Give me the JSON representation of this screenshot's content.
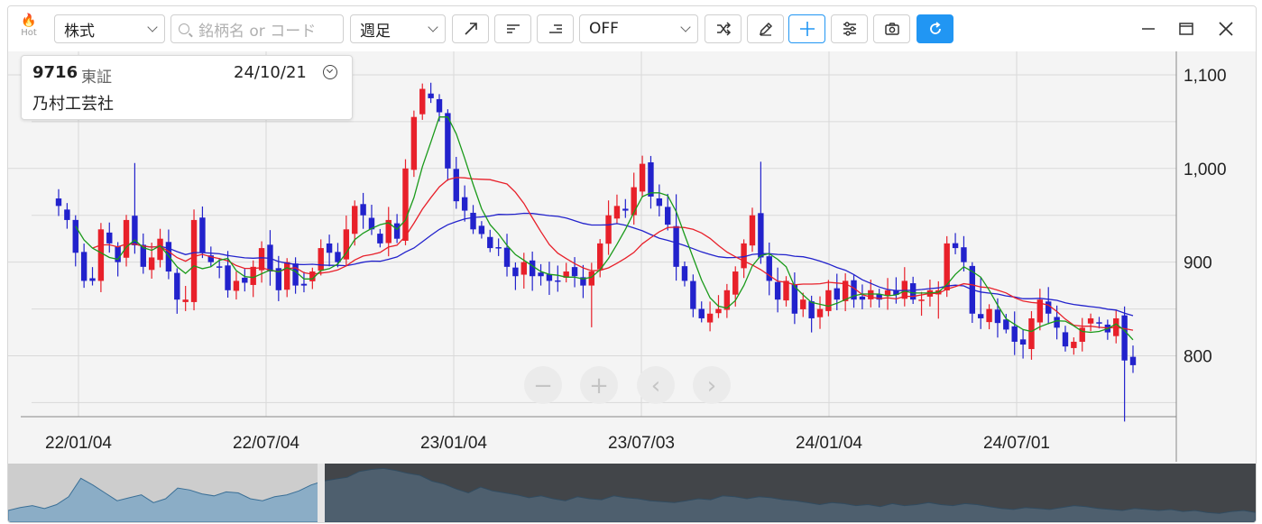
{
  "toolbar": {
    "hot_label": "Hot",
    "security_type": "株式",
    "search_placeholder": "銘柄名 or コード",
    "period": "週足",
    "indicator": "OFF",
    "icons": [
      "trend-line-icon",
      "horizontal-lines-icon",
      "right-aligned-lines-icon",
      "shuffle-icon",
      "pencil-icon",
      "crosshair-icon",
      "settings-sliders-icon",
      "camera-icon",
      "refresh-icon"
    ]
  },
  "window": {
    "icons": [
      "minimize-icon",
      "maximize-icon",
      "close-icon"
    ]
  },
  "stock": {
    "code": "9716",
    "market": "東証",
    "date": "24/10/21",
    "name": "乃村工芸社"
  },
  "chart_data": {
    "type": "candlestick",
    "interval": "weekly",
    "x_ticks": [
      "22/01/04",
      "22/07/04",
      "23/01/04",
      "23/07/03",
      "24/01/04",
      "24/07/01"
    ],
    "y_ticks": [
      1100,
      1000,
      900,
      800
    ],
    "y_range": [
      735,
      1125
    ],
    "colors": {
      "up": "#e8202a",
      "down": "#2222cc",
      "ma_short": "#1a9a1a",
      "ma_mid": "#e8202a",
      "ma_long": "#2222cc"
    },
    "close_path": [
      960,
      945,
      910,
      880,
      880,
      935,
      920,
      900,
      945,
      918,
      895,
      905,
      925,
      890,
      860,
      860,
      945,
      910,
      900,
      895,
      870,
      880,
      878,
      895,
      915,
      890,
      870,
      900,
      875,
      875,
      890,
      915,
      910,
      900,
      935,
      960,
      950,
      935,
      920,
      945,
      925,
      1000,
      1055,
      1085,
      1075,
      1060,
      1000,
      965,
      955,
      935,
      930,
      915,
      915,
      895,
      885,
      900,
      885,
      885,
      880,
      880,
      890,
      885,
      875,
      890,
      920,
      950,
      960,
      955,
      980,
      1005,
      970,
      960,
      940,
      895,
      880,
      850,
      840,
      845,
      850,
      870,
      890,
      920,
      950,
      905,
      880,
      860,
      880,
      845,
      860,
      840,
      850,
      870,
      860,
      880,
      860,
      860,
      870,
      860,
      870,
      865,
      880,
      860,
      860,
      870,
      870,
      920,
      915,
      900,
      845,
      840,
      850,
      835,
      828,
      815,
      812,
      840,
      860,
      845,
      830,
      810,
      815,
      830,
      840,
      835,
      825,
      840,
      795,
      790
    ]
  },
  "overview": {
    "type": "area",
    "values": [
      12,
      15,
      17,
      14,
      18,
      26,
      45,
      38,
      30,
      22,
      25,
      28,
      20,
      24,
      35,
      33,
      29,
      27,
      31,
      30,
      24,
      22,
      26,
      28,
      32,
      38,
      42,
      44,
      46,
      52,
      54,
      55,
      53,
      50,
      48,
      42,
      39,
      34,
      30,
      36,
      32,
      30,
      28,
      25,
      27,
      24,
      22,
      26,
      24,
      23,
      27,
      25,
      24,
      22,
      21,
      20,
      22,
      24,
      23,
      27,
      26,
      24,
      26,
      25,
      23,
      22,
      20,
      18,
      20,
      19,
      17,
      18,
      16,
      19,
      17,
      18,
      20,
      18,
      17,
      19,
      18,
      16,
      14,
      13,
      15,
      14,
      13,
      15,
      17,
      16,
      14,
      13,
      12,
      14,
      13,
      12,
      13,
      11,
      12,
      10,
      9,
      11,
      12,
      10
    ]
  }
}
